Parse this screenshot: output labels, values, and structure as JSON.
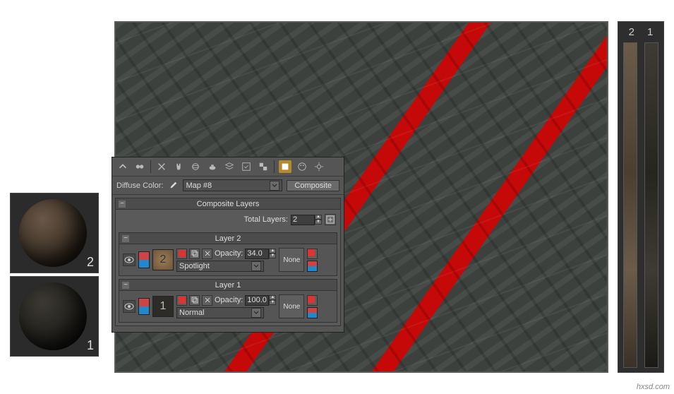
{
  "toolbar": {
    "icons": [
      "select",
      "link",
      "scissors",
      "hand",
      "sphere-row",
      "teapot",
      "layers",
      "check-square",
      "grid",
      "show-result",
      "palette",
      "settings"
    ]
  },
  "param": {
    "label": "Diffuse Color:",
    "map_name": "Map #8",
    "type_button": "Composite"
  },
  "rollout_main": {
    "title": "Composite Layers",
    "total_label": "Total Layers:",
    "total_value": "2"
  },
  "layers": [
    {
      "title": "Layer 2",
      "thumb_label": "2",
      "opacity_label": "Opacity:",
      "opacity_value": "34.0",
      "blend_mode": "Spotlight",
      "mask": "None"
    },
    {
      "title": "Layer 1",
      "thumb_label": "1",
      "opacity_label": "Opacity:",
      "opacity_value": "100.0",
      "blend_mode": "Normal",
      "mask": "None"
    }
  ],
  "spheres": {
    "labels": [
      "2",
      "1"
    ]
  },
  "strips": {
    "labels": [
      "2",
      "1"
    ]
  },
  "watermark": "hxsd.com"
}
